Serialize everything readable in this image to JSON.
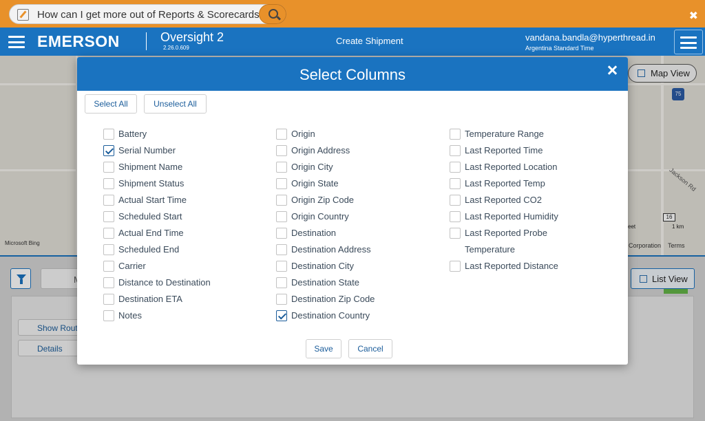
{
  "helpbar": {
    "text": "How can I get more out of Reports & Scorecards?"
  },
  "header": {
    "logo": "EMERSON",
    "app_name": "Oversight 2",
    "version": "2.26.0.609",
    "page_title": "Create Shipment",
    "user_email": "vandana.bandla@hyperthread.in",
    "timezone": "Argentina Standard Time"
  },
  "map": {
    "map_view_label": "Map View",
    "attribution": "Microsoft Bing",
    "highway_shield": "75",
    "road_label": "Jackson Rd",
    "route_shield": "16",
    "scale_label": "1 km",
    "scale_label_ft": "eet",
    "corp_label": "Corporation",
    "terms_label": "Terms"
  },
  "lower": {
    "tab_label": "M",
    "list_view_label": "List View",
    "show_route_label": "Show Rout",
    "details_label": "Details"
  },
  "modal": {
    "title": "Select Columns",
    "select_all": "Select All",
    "unselect_all": "Unselect All",
    "save": "Save",
    "cancel": "Cancel",
    "column1": [
      {
        "label": "Battery",
        "checked": false
      },
      {
        "label": "Serial Number",
        "checked": true
      },
      {
        "label": "Shipment Name",
        "checked": false
      },
      {
        "label": "Shipment Status",
        "checked": false
      },
      {
        "label": "Actual Start Time",
        "checked": false
      },
      {
        "label": "Scheduled Start",
        "checked": false
      },
      {
        "label": "Actual End Time",
        "checked": false
      },
      {
        "label": "Scheduled End",
        "checked": false
      },
      {
        "label": "Carrier",
        "checked": false
      },
      {
        "label": "Distance to Destination",
        "checked": false
      },
      {
        "label": "Destination ETA",
        "checked": false
      },
      {
        "label": "Notes",
        "checked": false
      }
    ],
    "column2": [
      {
        "label": "Origin",
        "checked": false
      },
      {
        "label": "Origin Address",
        "checked": false
      },
      {
        "label": "Origin City",
        "checked": false
      },
      {
        "label": "Origin State",
        "checked": false
      },
      {
        "label": "Origin Zip Code",
        "checked": false
      },
      {
        "label": "Origin Country",
        "checked": false
      },
      {
        "label": "Destination",
        "checked": false
      },
      {
        "label": "Destination Address",
        "checked": false
      },
      {
        "label": "Destination City",
        "checked": false
      },
      {
        "label": "Destination State",
        "checked": false
      },
      {
        "label": "Destination Zip Code",
        "checked": false
      },
      {
        "label": "Destination Country",
        "checked": true
      }
    ],
    "column3": [
      {
        "label": "Temperature Range",
        "checked": false
      },
      {
        "label": "Last Reported Time",
        "checked": false
      },
      {
        "label": "Last Reported Location",
        "checked": false
      },
      {
        "label": "Last Reported Temp",
        "checked": false
      },
      {
        "label": "Last Reported CO2",
        "checked": false
      },
      {
        "label": "Last Reported Humidity",
        "checked": false
      },
      {
        "label": "Last Reported Probe",
        "label_line2": "Temperature",
        "checked": false
      },
      {
        "label": "Last Reported Distance",
        "checked": false
      }
    ]
  }
}
